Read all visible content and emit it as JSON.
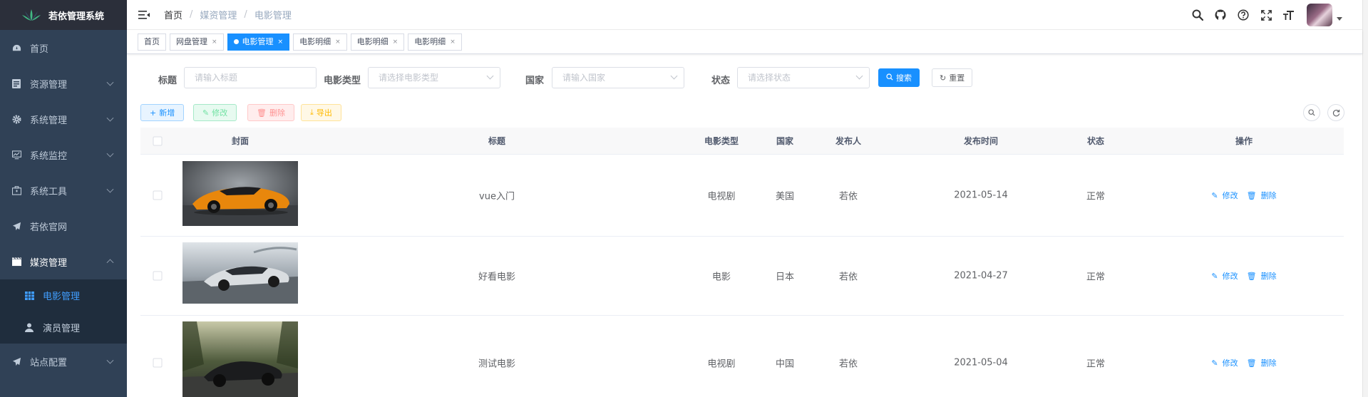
{
  "app": {
    "title": "若依管理系统"
  },
  "sidebar": {
    "items": [
      {
        "label": "首页",
        "icon": "dashboard-icon"
      },
      {
        "label": "资源管理",
        "icon": "document-icon"
      },
      {
        "label": "系统管理",
        "icon": "gear-icon"
      },
      {
        "label": "系统监控",
        "icon": "monitor-icon"
      },
      {
        "label": "系统工具",
        "icon": "toolbox-icon"
      },
      {
        "label": "若依官网",
        "icon": "send-icon"
      },
      {
        "label": "媒资管理",
        "icon": "clapper-icon"
      },
      {
        "label": "站点配置",
        "icon": "send-icon"
      }
    ],
    "submenu": [
      {
        "label": "电影管理",
        "icon": "table-icon",
        "active": true
      },
      {
        "label": "演员管理",
        "icon": "user-icon"
      }
    ]
  },
  "breadcrumb": [
    "首页",
    "媒资管理",
    "电影管理"
  ],
  "tags": [
    {
      "label": "首页"
    },
    {
      "label": "网盘管理"
    },
    {
      "label": "电影管理",
      "active": true
    },
    {
      "label": "电影明细"
    },
    {
      "label": "电影明细"
    },
    {
      "label": "电影明细"
    }
  ],
  "search": {
    "title_label": "标题",
    "title_placeholder": "请输入标题",
    "type_label": "电影类型",
    "type_placeholder": "请选择电影类型",
    "country_label": "国家",
    "country_placeholder": "请输入国家",
    "status_label": "状态",
    "status_placeholder": "请选择状态",
    "search_btn": "搜索",
    "reset_btn": "重置"
  },
  "toolbar": {
    "add": "新增",
    "edit": "修改",
    "delete": "删除",
    "export": "导出"
  },
  "table": {
    "columns": [
      "封面",
      "标题",
      "电影类型",
      "国家",
      "发布人",
      "发布时间",
      "状态",
      "操作"
    ],
    "rows": [
      {
        "title": "vue入门",
        "type": "电视剧",
        "country": "美国",
        "publisher": "若依",
        "date": "2021-05-14",
        "status": "正常",
        "cover": "orange-sports-car"
      },
      {
        "title": "好看电影",
        "type": "电影",
        "country": "日本",
        "publisher": "若依",
        "date": "2021-04-27",
        "status": "正常",
        "cover": "silver-concept-car"
      },
      {
        "title": "测试电影",
        "type": "电视剧",
        "country": "中国",
        "publisher": "若依",
        "date": "2021-05-04",
        "status": "正常",
        "cover": "black-hypercar"
      }
    ],
    "op_edit": "修改",
    "op_delete": "删除"
  },
  "colors": {
    "sidebar_bg": "#304156",
    "primary": "#1890ff",
    "active_menu": "#409eff"
  }
}
